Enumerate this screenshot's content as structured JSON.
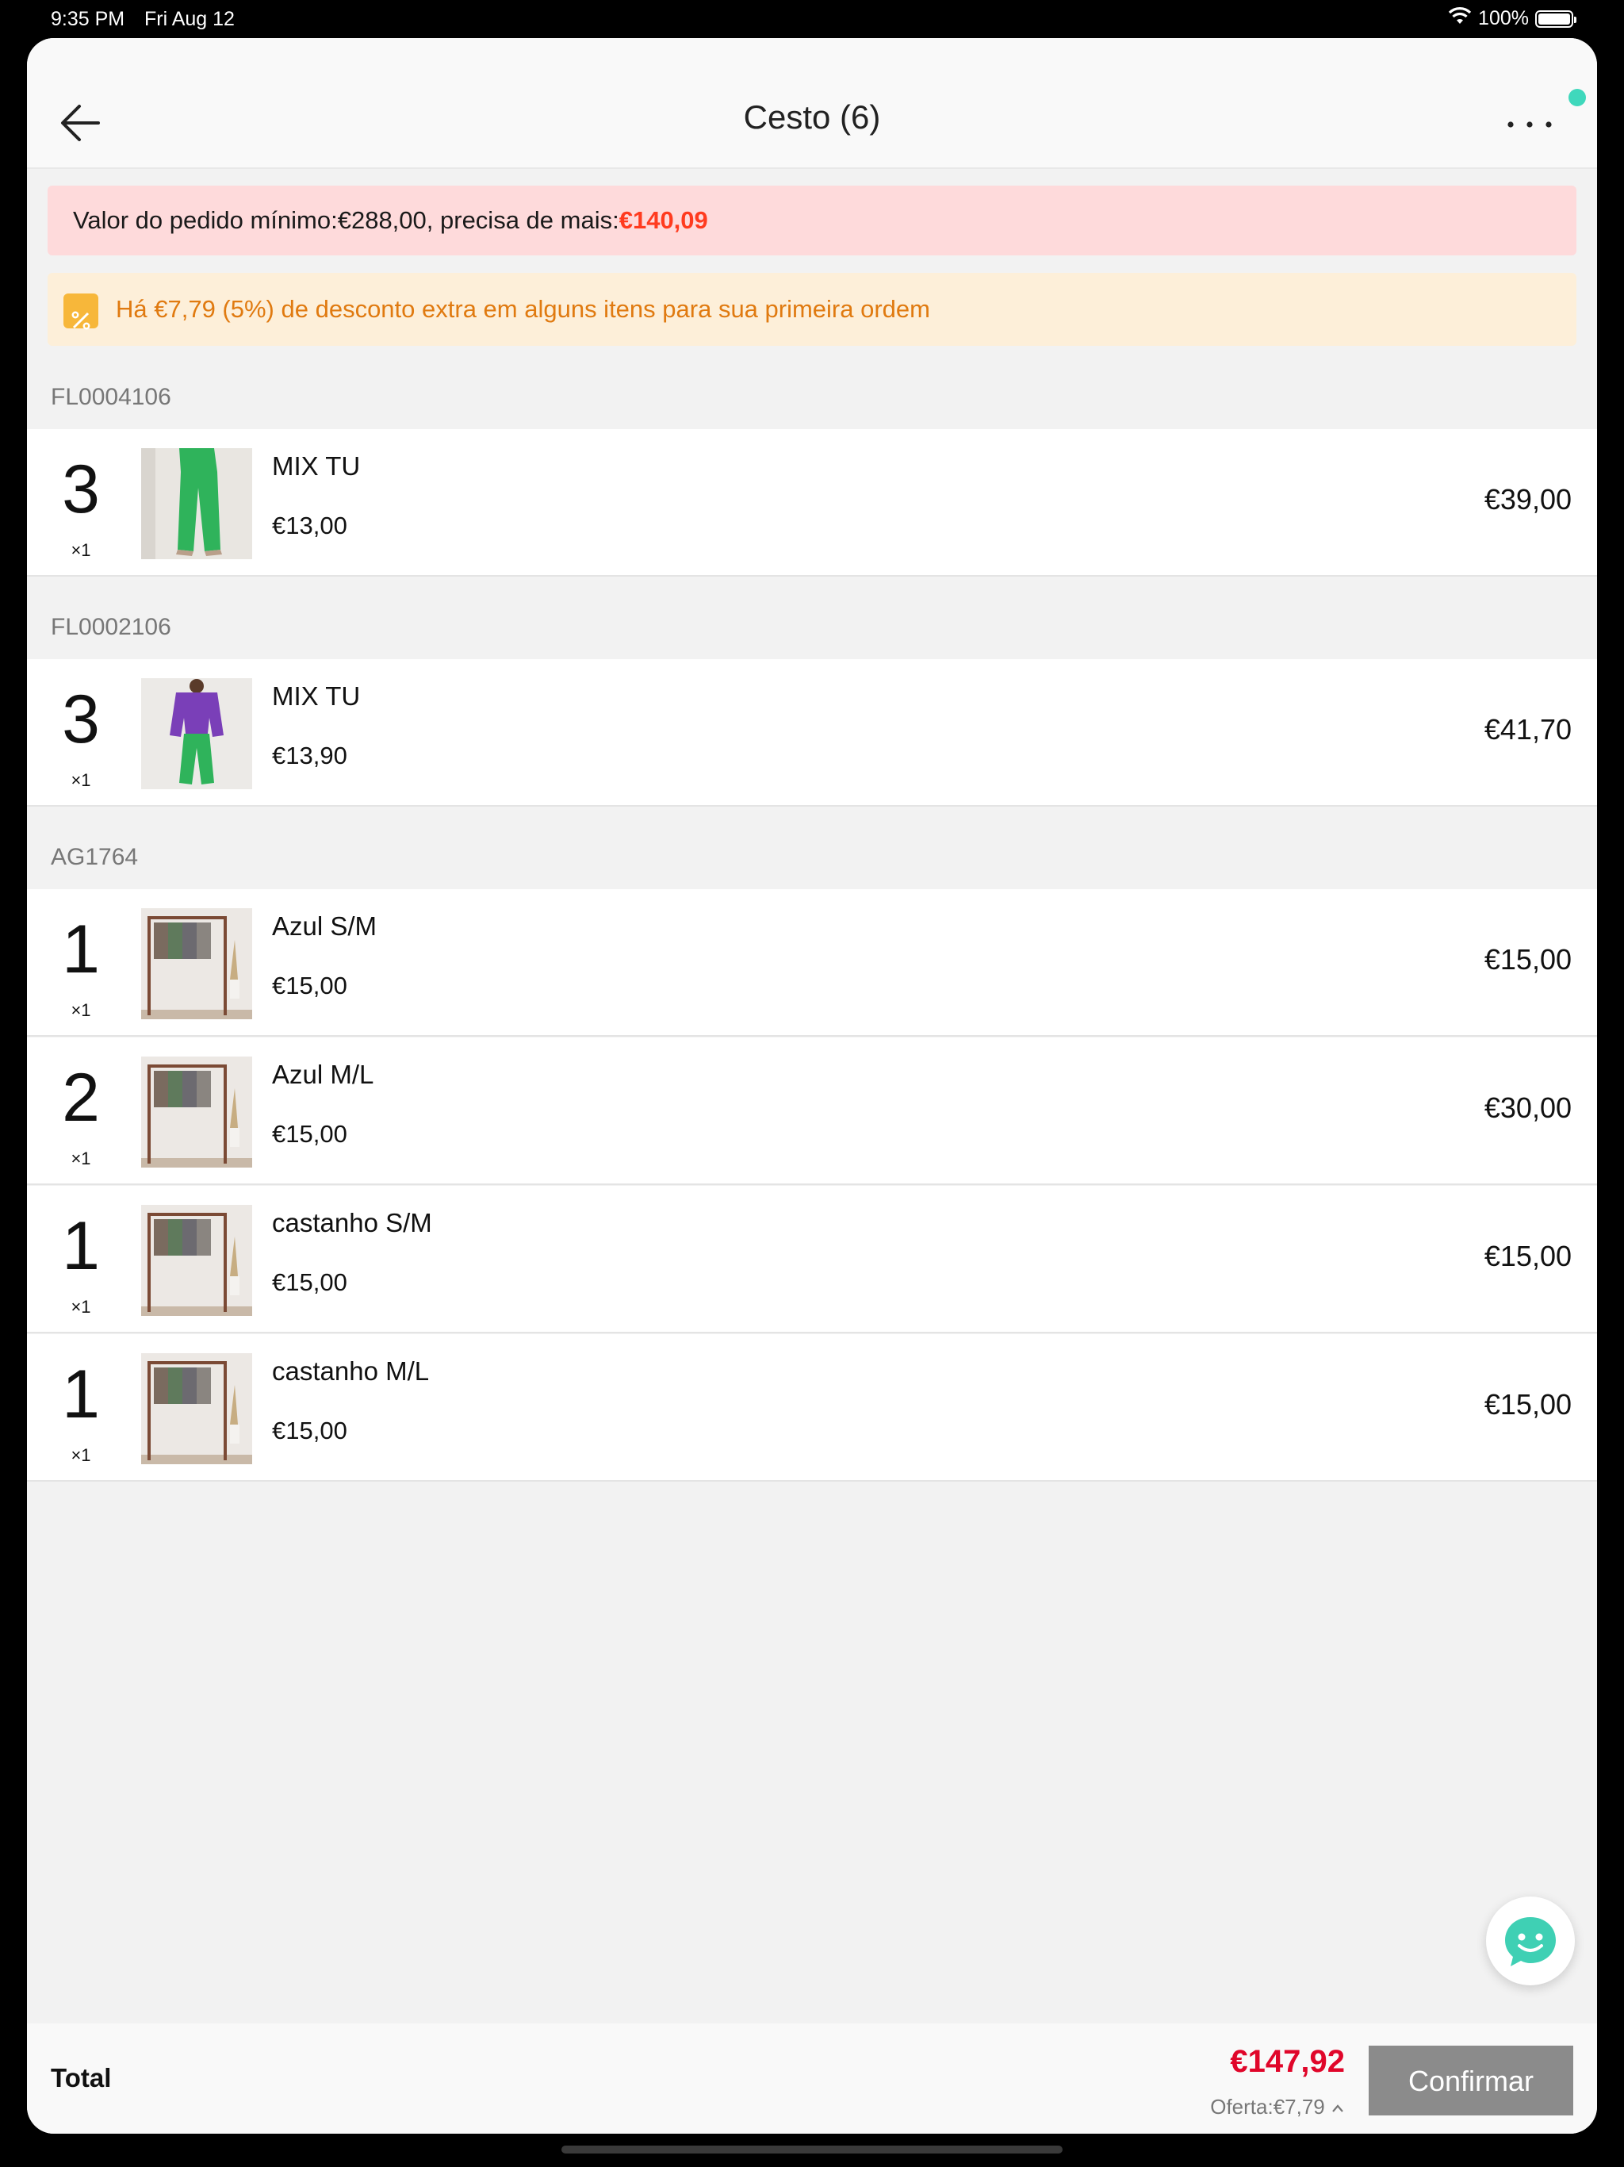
{
  "status": {
    "time": "9:35 PM",
    "date": "Fri Aug 12",
    "battery": "100%"
  },
  "nav": {
    "title": "Cesto (6)"
  },
  "min_order": {
    "label": "Valor do pedido mínimo:€288,00, precisa de mais:",
    "amount": "€140,09"
  },
  "discount": {
    "text": "Há €7,79 (5%) de desconto extra em alguns itens para sua primeira ordem"
  },
  "groups": [
    {
      "code": "FL0004106",
      "items": [
        {
          "qty": "3",
          "mult": "×1",
          "name": "MIX TU",
          "price": "€13,00",
          "total": "€39,00",
          "image": "green-trousers-photo"
        }
      ]
    },
    {
      "code": "FL0002106",
      "items": [
        {
          "qty": "3",
          "mult": "×1",
          "name": "MIX TU",
          "price": "€13,90",
          "total": "€41,70",
          "image": "purple-top-green-trousers-photo"
        }
      ]
    },
    {
      "code": "AG1764",
      "items": [
        {
          "qty": "1",
          "mult": "×1",
          "name": "Azul S/M",
          "price": "€15,00",
          "total": "€15,00",
          "image": "clothes-rack-photo"
        },
        {
          "qty": "2",
          "mult": "×1",
          "name": "Azul M/L",
          "price": "€15,00",
          "total": "€30,00",
          "image": "clothes-rack-photo"
        },
        {
          "qty": "1",
          "mult": "×1",
          "name": "castanho S/M",
          "price": "€15,00",
          "total": "€15,00",
          "image": "clothes-rack-photo"
        },
        {
          "qty": "1",
          "mult": "×1",
          "name": "castanho M/L",
          "price": "€15,00",
          "total": "€15,00",
          "image": "clothes-rack-photo"
        }
      ]
    }
  ],
  "footer": {
    "total_label": "Total",
    "total_amount": "€147,92",
    "offer": "Oferta:€7,79",
    "confirm_label": "Confirmar"
  },
  "colors": {
    "accent_red": "#e0062a",
    "warning_red": "#ff3b1f",
    "discount_orange": "#e07a10",
    "chat_teal": "#3fd8bc",
    "confirm_gray": "#8b8b8b"
  },
  "icons": [
    "wifi-icon",
    "battery-icon",
    "back-arrow-icon",
    "more-dots-icon",
    "percent-badge-icon",
    "chat-bot-icon",
    "chevron-up-icon"
  ]
}
